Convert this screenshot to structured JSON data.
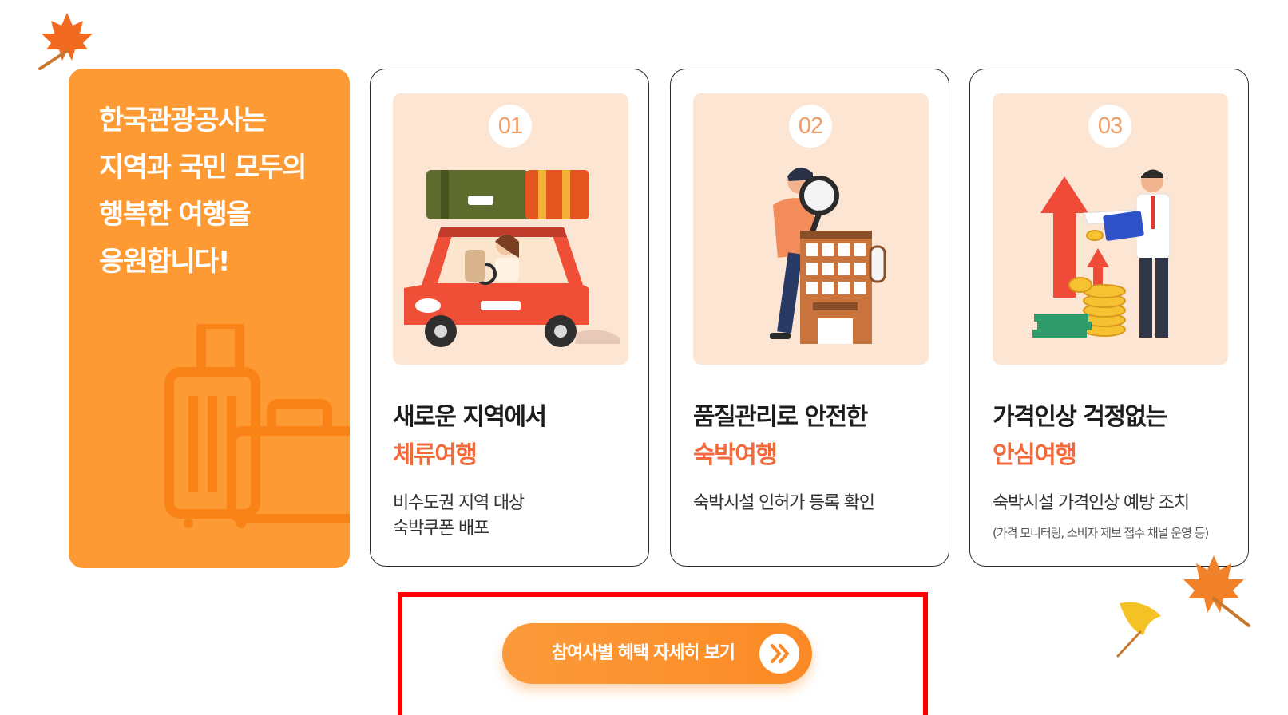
{
  "intro": {
    "lines": [
      "한국관광공사는",
      "지역과 국민 모두의",
      "행복한 여행을",
      "응원합니다!"
    ]
  },
  "cards": [
    {
      "number": "01",
      "title": "새로운 지역에서",
      "highlight": "체류여행",
      "description_lines": [
        "비수도권 지역 대상",
        "숙박쿠폰 배포"
      ],
      "illustration": "car-with-luggage-illustration"
    },
    {
      "number": "02",
      "title": "품질관리로 안전한",
      "highlight": "숙박여행",
      "description_lines": [
        "숙박시설 인허가 등록 확인"
      ],
      "illustration": "magnifier-inspecting-hotel-illustration"
    },
    {
      "number": "03",
      "title": "가격인상 걱정없는",
      "highlight": "안심여행",
      "description_lines": [
        "숙박시설 가격인상 예방 조치"
      ],
      "note": "(가격 모니터링, 소비자 제보 접수 채널 운영 등)",
      "illustration": "man-with-laptop-price-arrows-illustration"
    }
  ],
  "cta": {
    "label": "참여사별 혜택 자세히 보기",
    "icon": "double-chevron-right-icon"
  },
  "colors": {
    "accent_orange": "#fd9a33",
    "highlight_red": "#f26a3c",
    "illustration_bg": "#fde5d4",
    "selection_box": "#ff0000"
  },
  "decorations": [
    "maple-leaf-icon",
    "ginkgo-leaf-icon",
    "luggage-icon"
  ]
}
